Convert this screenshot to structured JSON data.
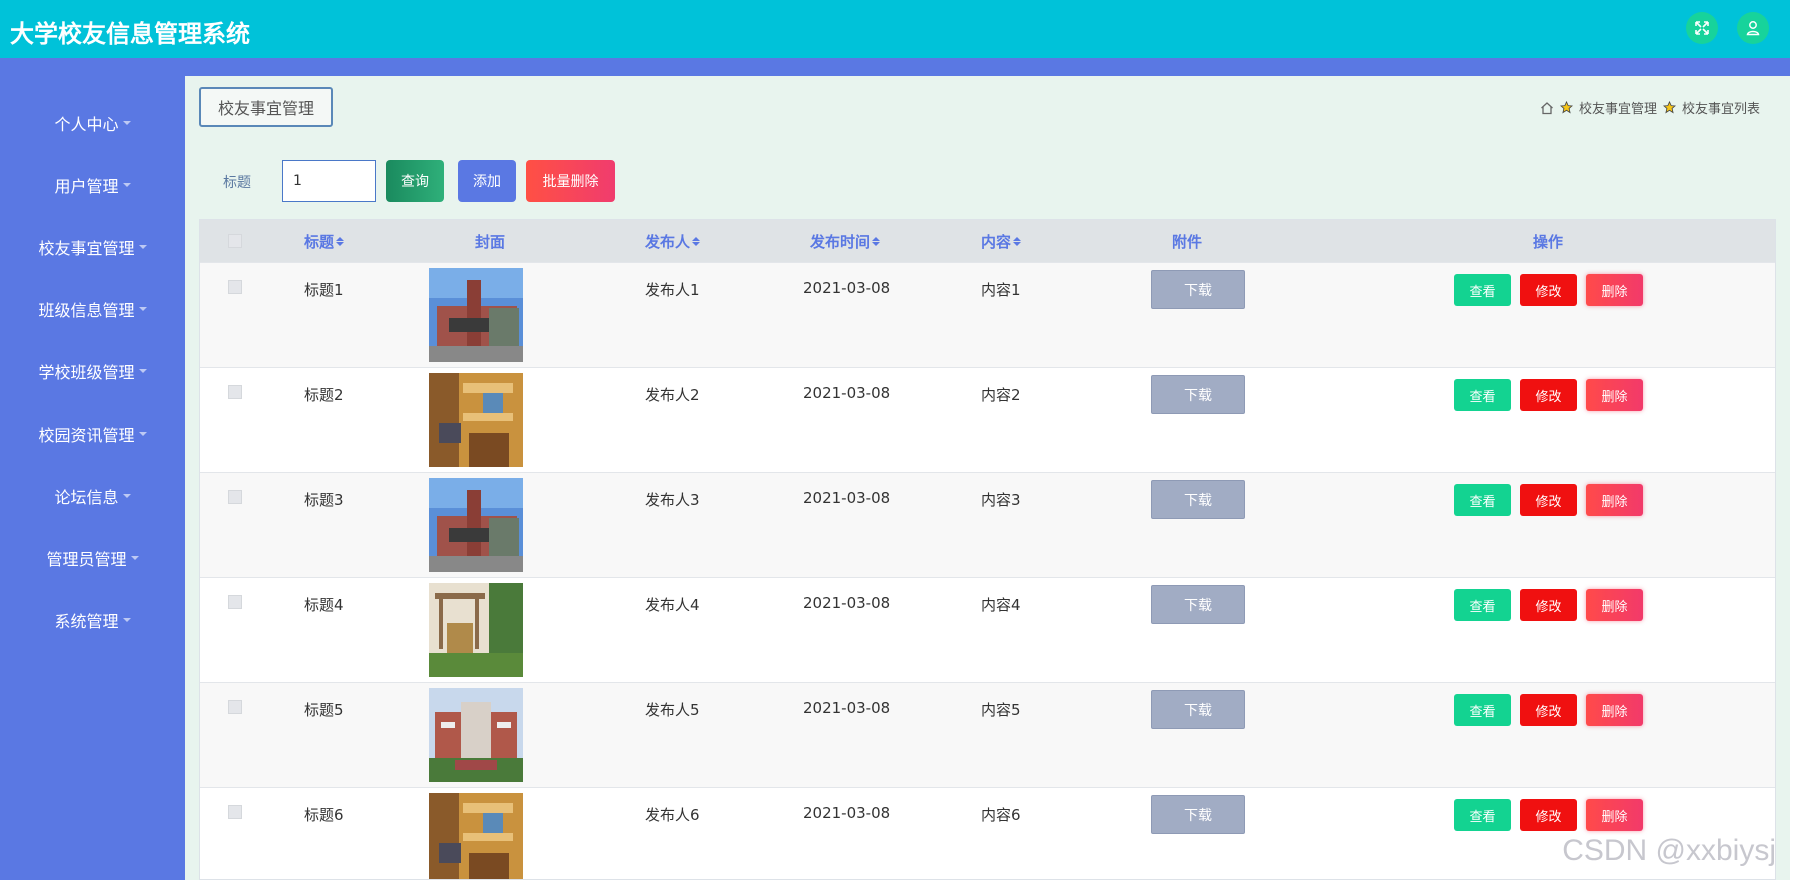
{
  "header": {
    "app_title": "大学校友信息管理系统",
    "icons": [
      "fullscreen-icon",
      "user-icon"
    ]
  },
  "sidebar": {
    "items": [
      {
        "label": "个人中心"
      },
      {
        "label": "用户管理"
      },
      {
        "label": "校友事宜管理"
      },
      {
        "label": "班级信息管理"
      },
      {
        "label": "学校班级管理"
      },
      {
        "label": "校园资讯管理"
      },
      {
        "label": "论坛信息"
      },
      {
        "label": "管理员管理"
      },
      {
        "label": "系统管理"
      }
    ]
  },
  "page": {
    "tag": "校友事宜管理",
    "breadcrumb": [
      "校友事宜管理",
      "校友事宜列表"
    ]
  },
  "search": {
    "label": "标题",
    "value": "1",
    "query_label": "查询",
    "add_label": "添加",
    "batch_delete_label": "批量删除"
  },
  "table": {
    "headers": {
      "title": "标题",
      "cover": "封面",
      "publisher": "发布人",
      "publish_time": "发布时间",
      "content": "内容",
      "attachment": "附件",
      "actions": "操作"
    },
    "rows": [
      {
        "title": "标题1",
        "publisher": "发布人1",
        "publish_time": "2021-03-08",
        "content": "内容1",
        "download": "下载",
        "view": "查看",
        "edit": "修改",
        "delete": "删除"
      },
      {
        "title": "标题2",
        "publisher": "发布人2",
        "publish_time": "2021-03-08",
        "content": "内容2",
        "download": "下载",
        "view": "查看",
        "edit": "修改",
        "delete": "删除"
      },
      {
        "title": "标题3",
        "publisher": "发布人3",
        "publish_time": "2021-03-08",
        "content": "内容3",
        "download": "下载",
        "view": "查看",
        "edit": "修改",
        "delete": "删除"
      },
      {
        "title": "标题4",
        "publisher": "发布人4",
        "publish_time": "2021-03-08",
        "content": "内容4",
        "download": "下载",
        "view": "查看",
        "edit": "修改",
        "delete": "删除"
      },
      {
        "title": "标题5",
        "publisher": "发布人5",
        "publish_time": "2021-03-08",
        "content": "内容5",
        "download": "下载",
        "view": "查看",
        "edit": "修改",
        "delete": "删除"
      },
      {
        "title": "标题6",
        "publisher": "发布人6",
        "publish_time": "2021-03-08",
        "content": "内容6",
        "download": "下载",
        "view": "查看",
        "edit": "修改",
        "delete": "删除"
      }
    ]
  },
  "watermark": "CSDN @xxbiysj",
  "colors": {
    "header": "#00c2d9",
    "sidebar": "#5a78e3",
    "main_bg": "#e8f4ee",
    "query": "#1e9a6a",
    "add": "#5a78e3",
    "batch_delete": "#f0506a",
    "view": "#13d391",
    "edit": "#f01010",
    "delete": "#f23a6a",
    "download": "#a1acc4"
  }
}
